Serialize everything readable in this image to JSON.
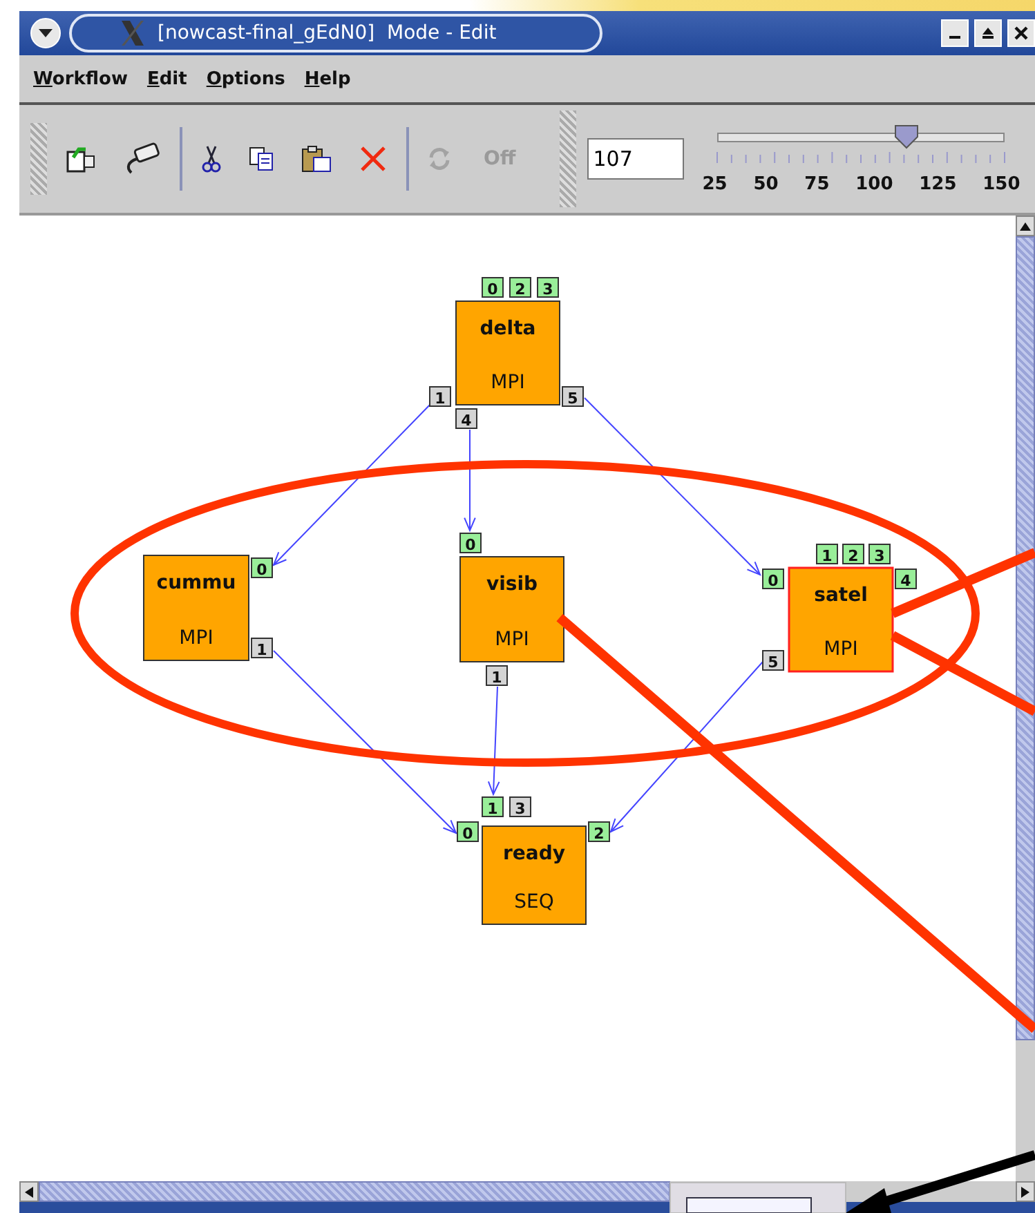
{
  "window": {
    "title": "[nowcast-final_gEdN0]  Mode - Edit"
  },
  "menu": [
    {
      "label": "Workflow"
    },
    {
      "label": "Edit"
    },
    {
      "label": "Options"
    },
    {
      "label": "Help"
    }
  ],
  "toolbar": {
    "buttons": [
      {
        "kind": "import",
        "disabled": false
      },
      {
        "kind": "connect",
        "disabled": false
      },
      {
        "kind": "cut",
        "disabled": false
      },
      {
        "kind": "copy",
        "disabled": false
      },
      {
        "kind": "paste",
        "disabled": false
      },
      {
        "kind": "delete",
        "disabled": false
      },
      {
        "kind": "refresh",
        "disabled": true
      },
      {
        "kind": "text",
        "label": "Off",
        "disabled": true
      }
    ],
    "zoom_field": {
      "value": "107"
    },
    "zoom_slider": {
      "level": 0.656,
      "labels": [
        "25",
        "50",
        "75",
        "100",
        "125",
        "150"
      ]
    }
  },
  "workflow": {
    "nodes": [
      {
        "name": "delta",
        "type": "MPI",
        "selected": false,
        "ports": [
          {
            "label": "0",
            "kind": "input"
          },
          {
            "label": "2",
            "kind": "input"
          },
          {
            "label": "3",
            "kind": "input"
          },
          {
            "label": "1",
            "kind": "output"
          },
          {
            "label": "4",
            "kind": "output"
          },
          {
            "label": "5",
            "kind": "output"
          }
        ]
      },
      {
        "name": "cummu",
        "type": "MPI",
        "selected": false,
        "ports": [
          {
            "label": "0",
            "kind": "input"
          },
          {
            "label": "1",
            "kind": "output"
          }
        ]
      },
      {
        "name": "visib",
        "type": "MPI",
        "selected": false,
        "ports": [
          {
            "label": "0",
            "kind": "input"
          },
          {
            "label": "1",
            "kind": "output"
          }
        ]
      },
      {
        "name": "satel",
        "type": "MPI",
        "selected": true,
        "ports": [
          {
            "label": "1",
            "kind": "input"
          },
          {
            "label": "2",
            "kind": "input"
          },
          {
            "label": "3",
            "kind": "input"
          },
          {
            "label": "0",
            "kind": "input"
          },
          {
            "label": "4",
            "kind": "input"
          },
          {
            "label": "5",
            "kind": "output"
          }
        ]
      },
      {
        "name": "ready",
        "type": "SEQ",
        "selected": false,
        "ports": [
          {
            "label": "1",
            "kind": "input"
          },
          {
            "label": "3",
            "kind": "output"
          },
          {
            "label": "0",
            "kind": "input"
          },
          {
            "label": "2",
            "kind": "input"
          }
        ]
      }
    ]
  }
}
